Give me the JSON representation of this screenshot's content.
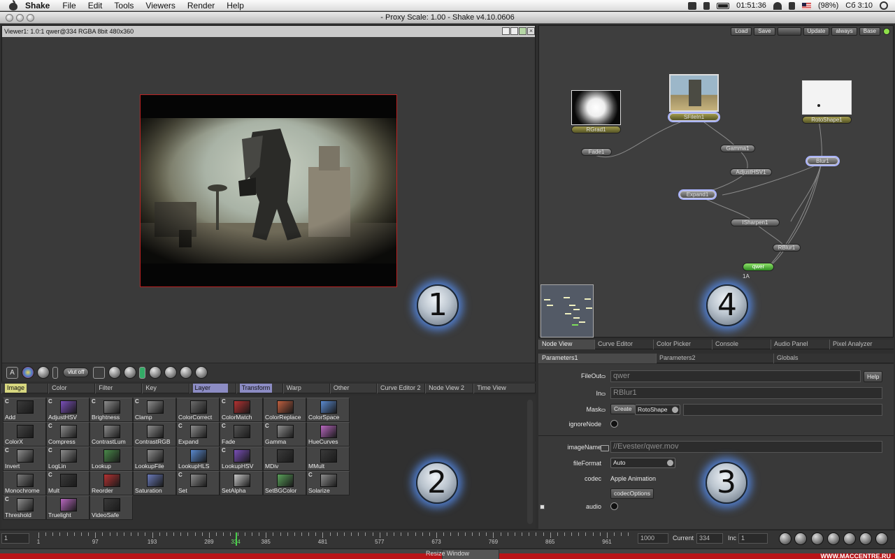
{
  "menubar": {
    "app": "Shake",
    "menus": [
      "File",
      "Edit",
      "Tools",
      "Viewers",
      "Render",
      "Help"
    ],
    "clock": "01:51:36",
    "battery": "(98%)",
    "datetime": "Сб 3:10"
  },
  "window": {
    "title": "- Proxy Scale: 1.00 - Shake v4.10.0606"
  },
  "viewer": {
    "info": "Viewer1: 1.0:1 qwer@334 RGBA 8bit 480x360",
    "vlut_label": "vlut off",
    "badge": "1"
  },
  "tool_tabs": [
    "Image",
    "Color",
    "Filter",
    "Key",
    "Layer",
    "Transform",
    "Warp",
    "Other",
    "Curve Editor 2",
    "Node View 2",
    "Time View"
  ],
  "tools": [
    {
      "label": "Add",
      "color": "#3a3a3a",
      "c": true
    },
    {
      "label": "AdjustHSV",
      "color": "#7a4fb8",
      "c": true
    },
    {
      "label": "Brightness",
      "color": "#8d8d8d",
      "c": true
    },
    {
      "label": "Clamp",
      "color": "#8d8d8d",
      "c": true
    },
    {
      "label": "ColorCorrect",
      "color": "#6c6c6c",
      "c": false
    },
    {
      "label": "ColorMatch",
      "color": "#b43232",
      "c": true
    },
    {
      "label": "ColorReplace",
      "color": "#c06040",
      "c": false
    },
    {
      "label": "ColorSpace",
      "color": "#5a8ad0",
      "c": false
    },
    {
      "label": "ColorX",
      "color": "#444444",
      "c": false
    },
    {
      "label": "Compress",
      "color": "#8d8d8d",
      "c": true
    },
    {
      "label": "ContrastLum",
      "color": "#8d8d8d",
      "c": false
    },
    {
      "label": "ContrastRGB",
      "color": "#8d8d8d",
      "c": false
    },
    {
      "label": "Expand",
      "color": "#8d8d8d",
      "c": true
    },
    {
      "label": "Fade",
      "color": "#555555",
      "c": true
    },
    {
      "label": "Gamma",
      "color": "#8d8d8d",
      "c": true
    },
    {
      "label": "HueCurves",
      "color": "#b868c0",
      "c": false
    },
    {
      "label": "Invert",
      "color": "#8d8d8d",
      "c": true
    },
    {
      "label": "LogLin",
      "color": "#8d8d8d",
      "c": true
    },
    {
      "label": "Lookup",
      "color": "#4a8a4a",
      "c": false
    },
    {
      "label": "LookupFile",
      "color": "#8d8d8d",
      "c": false
    },
    {
      "label": "LookupHLS",
      "color": "#5a8ad0",
      "c": false
    },
    {
      "label": "LookupHSV",
      "color": "#7a4fb8",
      "c": true
    },
    {
      "label": "MDiv",
      "color": "#3a3a3a",
      "c": false
    },
    {
      "label": "MMult",
      "color": "#3a3a3a",
      "c": false
    },
    {
      "label": "Monochrome",
      "color": "#7a7a7a",
      "c": false
    },
    {
      "label": "Mult",
      "color": "#3a3a3a",
      "c": true
    },
    {
      "label": "Reorder",
      "color": "#b43232",
      "c": false
    },
    {
      "label": "Saturation",
      "color": "#6a7ab8",
      "c": false
    },
    {
      "label": "Set",
      "color": "#8d8d8d",
      "c": true
    },
    {
      "label": "SetAlpha",
      "color": "#c8c8c8",
      "c": false
    },
    {
      "label": "SetBGColor",
      "color": "#5aa05a",
      "c": false
    },
    {
      "label": "Solarize",
      "color": "#8d8d8d",
      "c": true
    },
    {
      "label": "Threshold",
      "color": "#8d8d8d",
      "c": true
    },
    {
      "label": "Truelight",
      "color": "#b868c0",
      "c": false
    },
    {
      "label": "VideoSafe",
      "color": "#3a3a3a",
      "c": false
    }
  ],
  "tools_badge": "2",
  "nodeview": {
    "buttons": [
      "Load",
      "Save",
      "Update",
      "always",
      "Base"
    ],
    "nodes": [
      {
        "name": "RGrad1"
      },
      {
        "name": "SFileIn1"
      },
      {
        "name": "RotoShape1"
      },
      {
        "name": "Fade1"
      },
      {
        "name": "Gamma1"
      },
      {
        "name": "AdjustHSV1"
      },
      {
        "name": "Blur1"
      },
      {
        "name": "Expand1"
      },
      {
        "name": "ISharpen1"
      },
      {
        "name": "RBlur1"
      },
      {
        "name": "qwer"
      }
    ],
    "output_label": "1A",
    "badge": "4"
  },
  "panel_tabs": [
    "Node View",
    "Curve Editor",
    "Color Picker",
    "Console",
    "Audio Panel",
    "Pixel Analyzer"
  ],
  "param_tabs": [
    "Parameters1",
    "Parameters2",
    "Globals"
  ],
  "params": {
    "fileout_label": "FileOut",
    "fileout_value": "qwer",
    "help": "Help",
    "in_label": "In",
    "in_value": "RBlur1",
    "mask_label": "Mask",
    "create": "Create",
    "mask_shape": "RotoShape",
    "ignore_label": "ignoreNode",
    "imagename_label": "imageName",
    "imagename_value": "//Evester/qwer.mov",
    "fileformat_label": "fileFormat",
    "fileformat_value": "Auto",
    "codec_label": "codec",
    "codec_value": "Apple Animation",
    "codec_options": "codecOptions",
    "audio_label": "audio",
    "badge": "3"
  },
  "timeline": {
    "start": "1",
    "end": "1000",
    "current_label": "Current",
    "current_value": "334",
    "inc_label": "Inc",
    "inc_value": "1",
    "marks": [
      "1",
      "97",
      "193",
      "289",
      "334",
      "385",
      "481",
      "577",
      "673",
      "769",
      "865",
      "961"
    ]
  },
  "status": {
    "text": "Resize Window",
    "watermark": "WWW.MACCENTRE.RU"
  }
}
